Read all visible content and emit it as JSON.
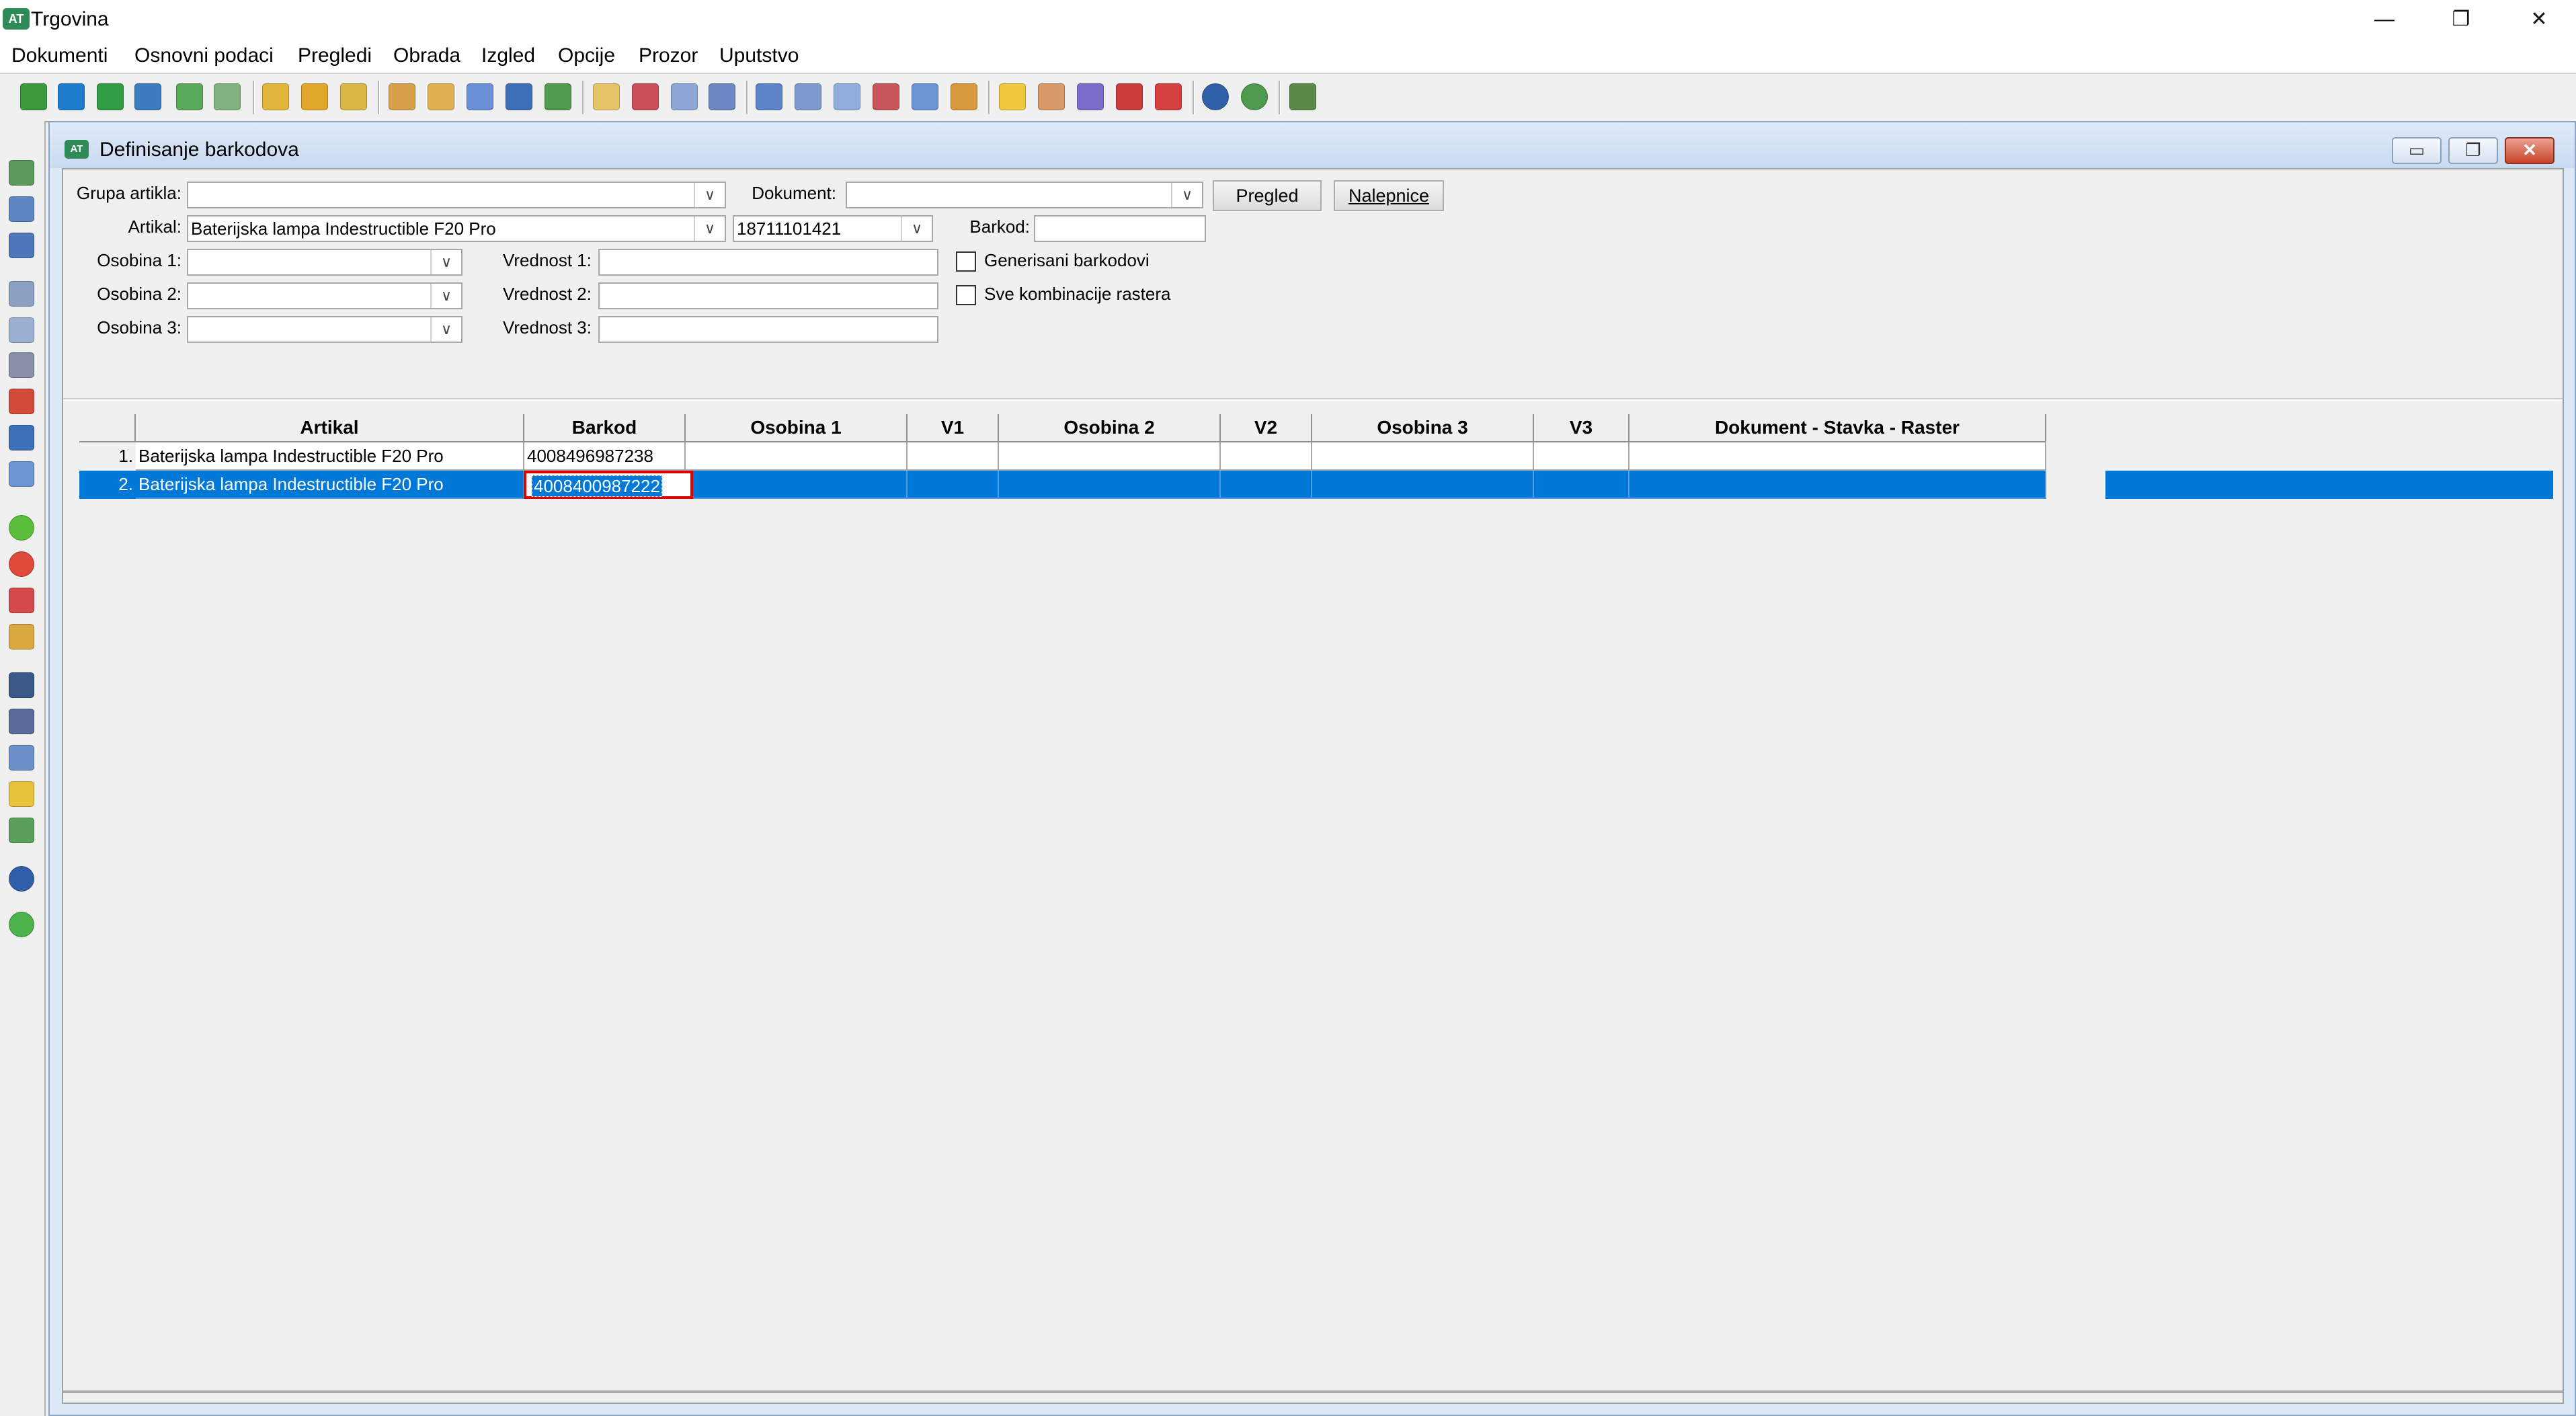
{
  "window": {
    "app_logo": "AT",
    "title": "Trgovina",
    "minimize": "—",
    "restore": "❐",
    "close": "✕"
  },
  "menu": [
    "Dokumenti",
    "Osnovni podaci",
    "Pregledi",
    "Obrada",
    "Izgled",
    "Opcije",
    "Prozor",
    "Uputstvo"
  ],
  "toolbar_icons": [
    "one-icon",
    "blue-arrow-icon",
    "green-arrow-icon",
    "import-icon",
    "export-icon",
    "document-icon",
    "folder-open-icon",
    "folder-edit-icon",
    "folder-check-icon",
    "envelope-icon",
    "pencil-doc-icon",
    "doc-gear-icon",
    "blue-box-icon",
    "green-box-icon",
    "copy-icon",
    "delete-doc-icon",
    "sum-icon",
    "calendar-icon",
    "layout-icon",
    "table-icon",
    "docs-icon",
    "cards-icon",
    "list-image-icon",
    "package-icon",
    "lightbulb-icon",
    "tag-icon",
    "gear-icon",
    "dollar-icon",
    "gem-icon",
    "help-icon",
    "globe-icon",
    "exit-icon"
  ],
  "sidebar_icons": [
    "save-icon",
    "save-as-icon",
    "save-all-icon",
    "print-icon",
    "print-setup-icon",
    "settings-icon",
    "stack-icon",
    "cube-icon",
    "report-icon",
    "add-icon",
    "remove-icon",
    "undo-icon",
    "edit-icon",
    "find-icon",
    "find-next-icon",
    "sort-icon",
    "filter-icon",
    "expand-icon",
    "help-icon",
    "next-icon"
  ],
  "child_window": {
    "logo": "AT",
    "title": "Definisanje barkodova",
    "minimize": "▭",
    "restore": "❐",
    "close": "✕"
  },
  "form": {
    "grupa_artikla_label": "Grupa artikla:",
    "grupa_artikla_value": "",
    "dokument_label": "Dokument:",
    "dokument_value": "",
    "pregled_button": "Pregled",
    "nalepnice_button": "Nalepnice",
    "artikal_label": "Artikal:",
    "artikal_value": "Baterijska lampa Indestructible F20 Pro",
    "artikal_code": "18711101421",
    "barkod_label": "Barkod:",
    "barkod_value": "",
    "osobina1_label": "Osobina 1:",
    "osobina2_label": "Osobina 2:",
    "osobina3_label": "Osobina 3:",
    "vrednost1_label": "Vrednost 1:",
    "vrednost2_label": "Vrednost 2:",
    "vrednost3_label": "Vrednost 3:",
    "generisani_label": "Generisani barkodovi",
    "generisani_checked": false,
    "sve_kombinacije_label": "Sve kombinacije rastera",
    "sve_kombinacije_checked": false
  },
  "grid": {
    "columns": [
      "Artikal",
      "Barkod",
      "Osobina 1",
      "V1",
      "Osobina 2",
      "V2",
      "Osobina 3",
      "V3",
      "Dokument - Stavka - Raster"
    ],
    "rows": [
      {
        "num": "1.",
        "artikal": "Baterijska lampa Indestructible F20 Pro",
        "barkod": "4008496987238",
        "osobina1": "",
        "v1": "",
        "osobina2": "",
        "v2": "",
        "osobina3": "",
        "v3": "",
        "dokument": ""
      },
      {
        "num": "2.",
        "artikal": "Baterijska lampa Indestructible F20 Pro",
        "barkod": "4008400987222",
        "osobina1": "",
        "v1": "",
        "osobina2": "",
        "v2": "",
        "osobina3": "",
        "v3": "",
        "dokument": ""
      }
    ],
    "selected_row": 2
  }
}
